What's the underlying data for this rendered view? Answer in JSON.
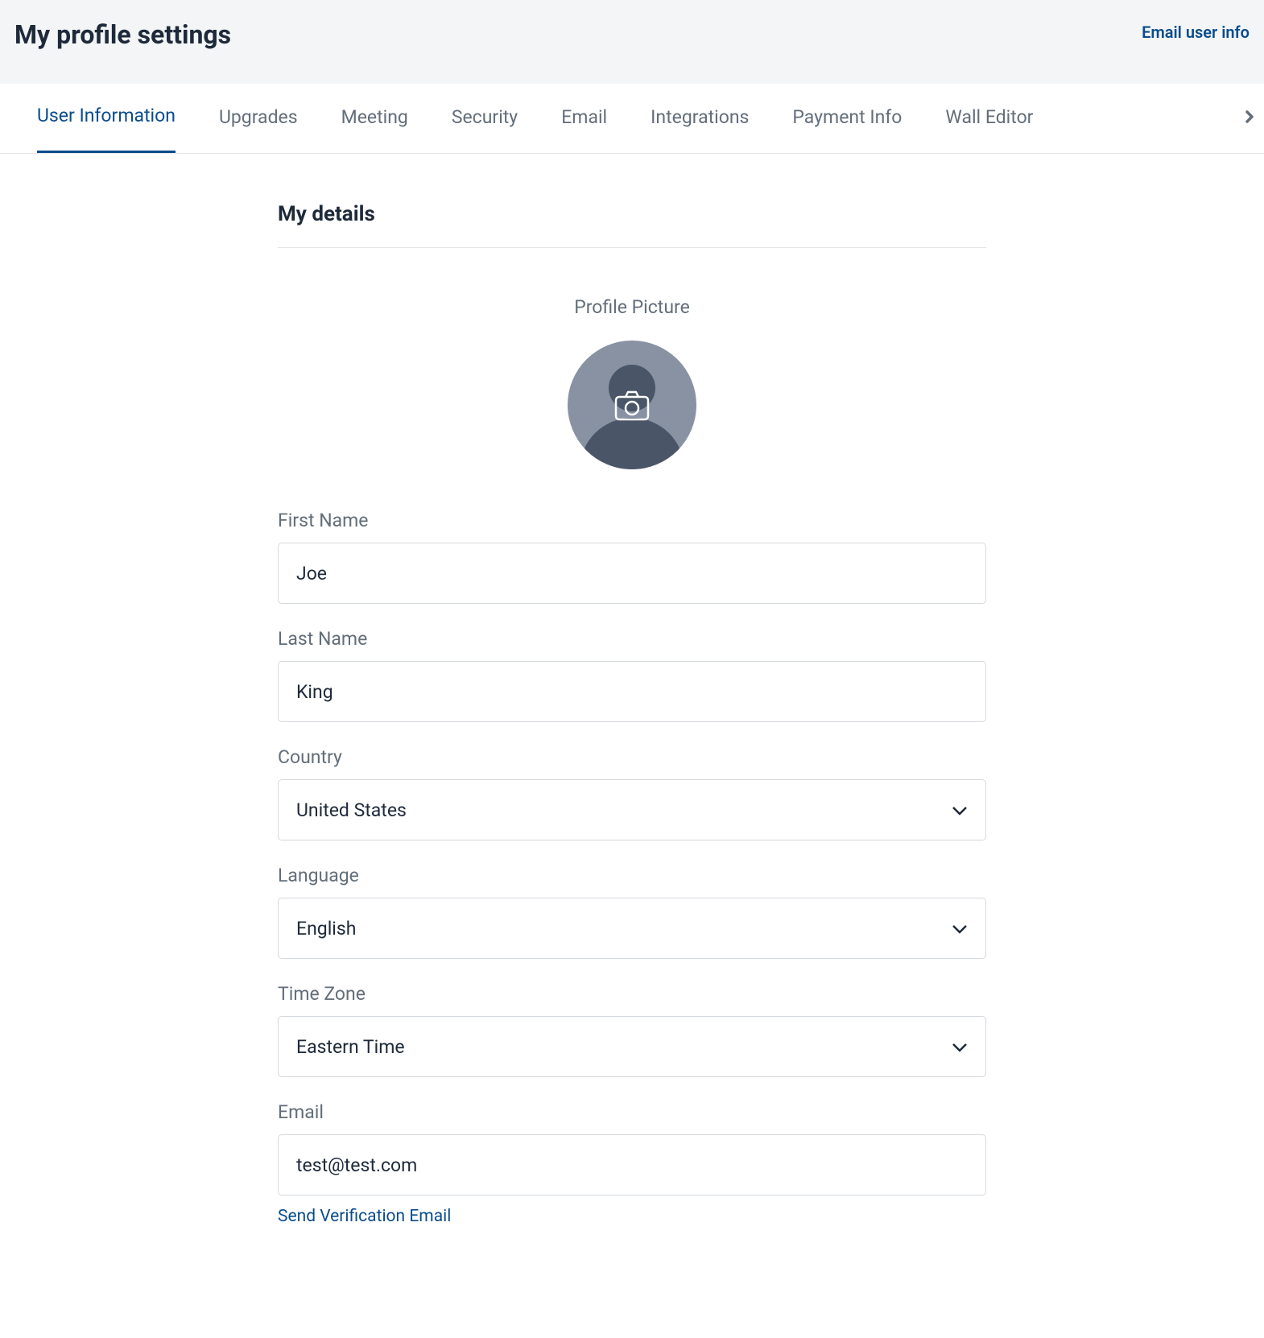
{
  "header": {
    "title": "My profile settings",
    "email_link": "Email user info"
  },
  "tabs": [
    {
      "label": "User Information",
      "active": true
    },
    {
      "label": "Upgrades",
      "active": false
    },
    {
      "label": "Meeting",
      "active": false
    },
    {
      "label": "Security",
      "active": false
    },
    {
      "label": "Email",
      "active": false
    },
    {
      "label": "Integrations",
      "active": false
    },
    {
      "label": "Payment Info",
      "active": false
    },
    {
      "label": "Wall Editor",
      "active": false
    }
  ],
  "section": {
    "title": "My details",
    "profile_picture_label": "Profile Picture"
  },
  "fields": {
    "first_name": {
      "label": "First Name",
      "value": "Joe"
    },
    "last_name": {
      "label": "Last Name",
      "value": "King"
    },
    "country": {
      "label": "Country",
      "value": "United States"
    },
    "language": {
      "label": "Language",
      "value": "English"
    },
    "timezone": {
      "label": "Time Zone",
      "value": "Eastern Time"
    },
    "email": {
      "label": "Email",
      "value": "test@test.com",
      "verify_link": "Send Verification Email"
    }
  }
}
